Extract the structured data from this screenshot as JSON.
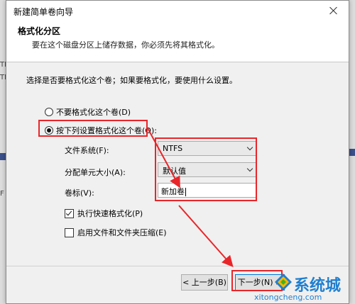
{
  "background": {
    "fragments": [
      "TF",
      "TF",
      "F"
    ]
  },
  "window": {
    "title": "新建简单卷向导"
  },
  "header": {
    "title": "格式化分区",
    "subtitle": "要在这个磁盘分区上储存数据，你必须先将其格式化。"
  },
  "content": {
    "prompt": "选择是否要格式化这个卷；如果要格式化，要使用什么设置。",
    "radio_no_format": "不要格式化这个卷(D)",
    "radio_format": "按下列设置格式化这个卷(O):",
    "fs_label": "文件系统(F):",
    "fs_value": "NTFS",
    "alloc_label": "分配单元大小(A):",
    "alloc_value": "默认值",
    "volume_label": "卷标(V):",
    "volume_value": "新加卷",
    "quick_format": "执行快速格式化(P)",
    "compression": "启用文件和文件夹压缩(E)"
  },
  "footer": {
    "back_label": "< 上一步(B)",
    "next_label": "下一步(N) >"
  },
  "watermark": {
    "brand": "系统城",
    "url": "xitongcheng.com"
  },
  "colors": {
    "highlight": "#e8262a",
    "accent": "#1f7fd0"
  }
}
